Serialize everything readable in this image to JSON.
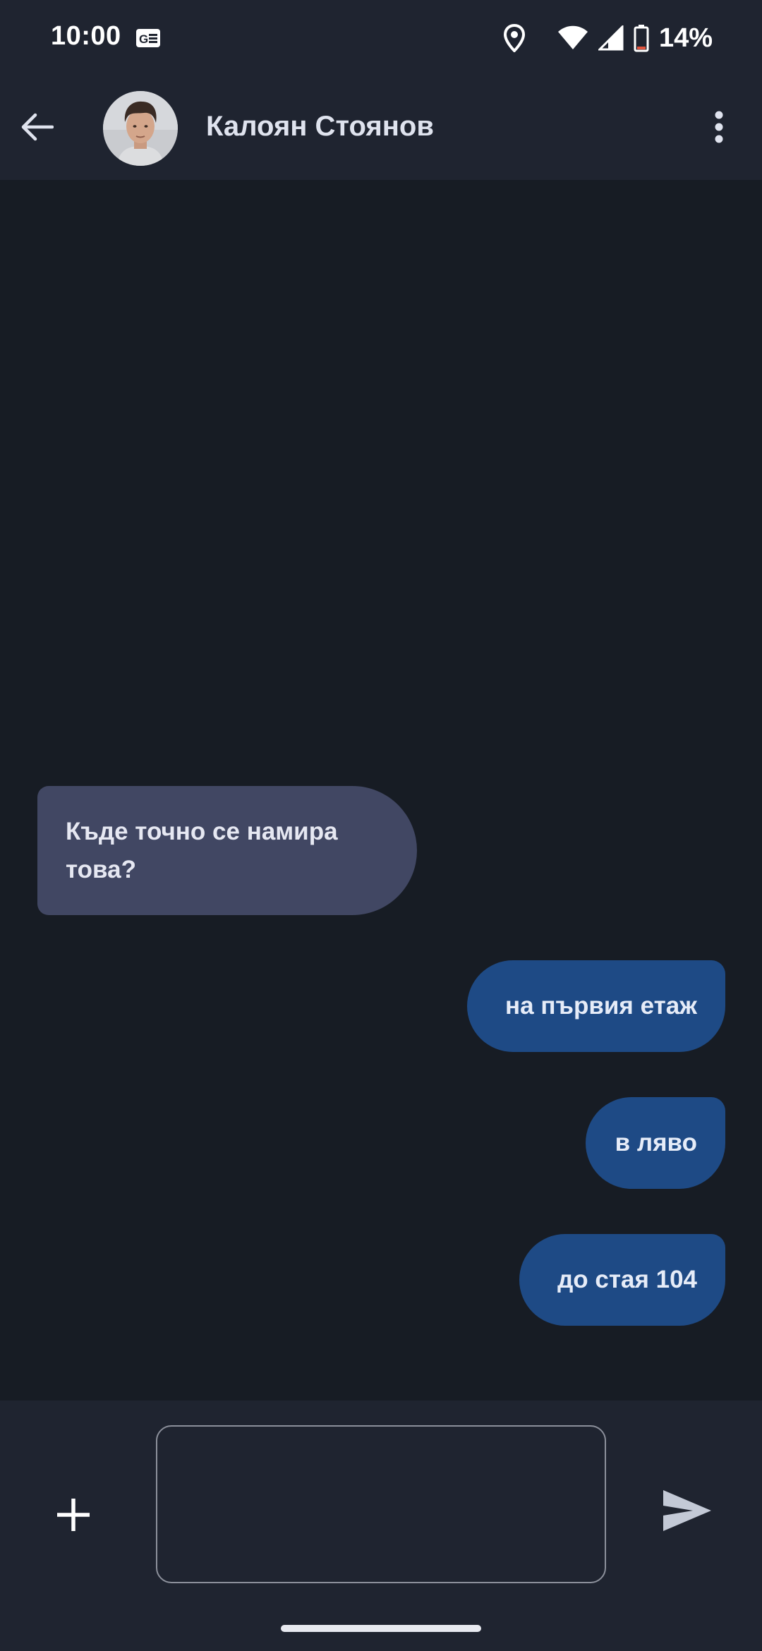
{
  "status_bar": {
    "time": "10:00",
    "battery_percent": "14%",
    "icons": [
      "notification-icon",
      "location-icon",
      "wifi-icon",
      "signal-icon",
      "battery-icon"
    ]
  },
  "header": {
    "contact_name": "Калоян Стоянов",
    "icons": [
      "back-arrow-icon",
      "avatar",
      "more-vert-icon"
    ]
  },
  "messages": [
    {
      "direction": "incoming",
      "text": "Къде точно се намира това?"
    },
    {
      "direction": "outgoing",
      "text": "на първия етаж"
    },
    {
      "direction": "outgoing",
      "text": "в ляво"
    },
    {
      "direction": "outgoing",
      "text": "до стая 104"
    }
  ],
  "composer": {
    "value": "",
    "placeholder": "",
    "icons": [
      "add-icon",
      "send-icon"
    ]
  },
  "colors": {
    "background": "#171c24",
    "bar": "#1f2430",
    "incoming_bubble": "#414763",
    "outgoing_bubble": "#1e4a85"
  }
}
